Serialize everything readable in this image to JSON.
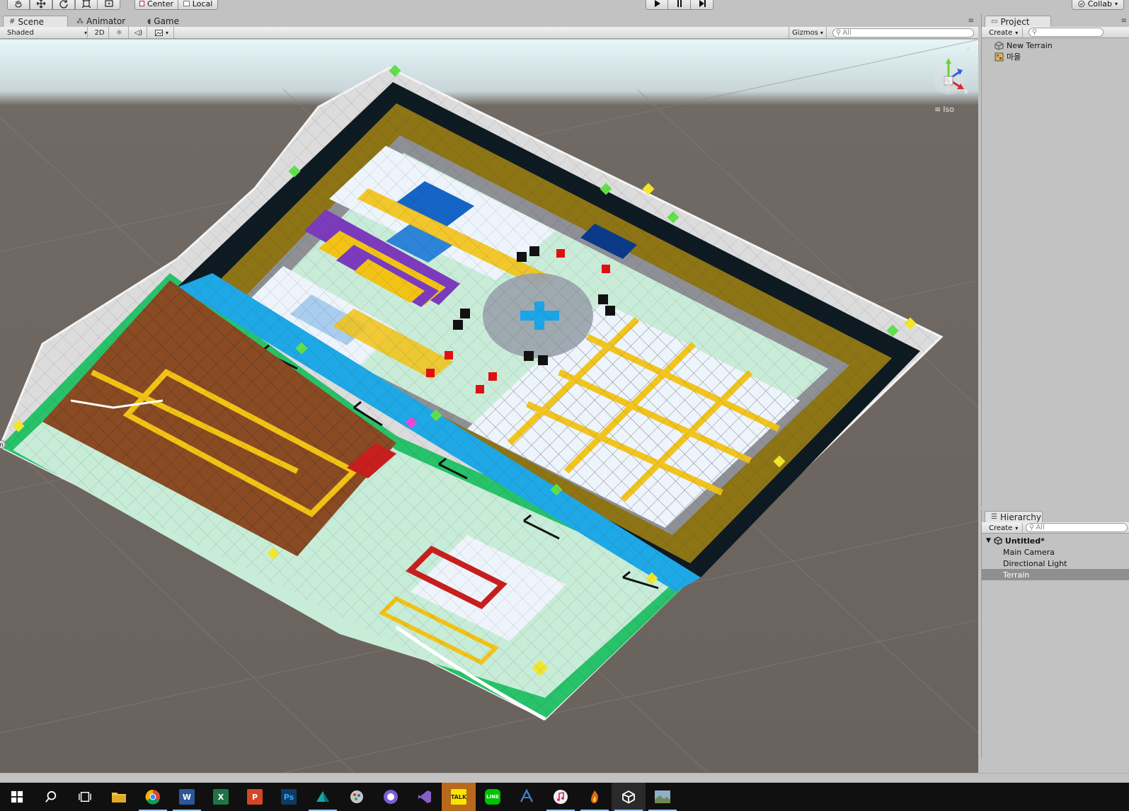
{
  "toolbar": {
    "pivot_center": "Center",
    "pivot_local": "Local",
    "collab": "Collab"
  },
  "scene": {
    "tabs": [
      {
        "label": "Scene",
        "icon": "grid-icon"
      },
      {
        "label": "Animator",
        "icon": "animator-icon"
      },
      {
        "label": "Game",
        "icon": "game-icon"
      }
    ],
    "shading_mode": "Shaded",
    "mode_2d": "2D",
    "gizmos_label": "Gizmos",
    "search_placeholder": "All",
    "projection_label": "Iso",
    "gizmo_axis_x": "x"
  },
  "project": {
    "tab_label": "Project",
    "create_label": "Create",
    "items": [
      {
        "label": "New Terrain",
        "icon": "terrain-asset-icon"
      },
      {
        "label": "마을",
        "icon": "scene-asset-icon"
      }
    ]
  },
  "hierarchy": {
    "tab_label": "Hierarchy",
    "create_label": "Create",
    "search_placeholder": "All",
    "scene_name": "Untitled*",
    "items": [
      {
        "label": "Main Camera",
        "selected": false
      },
      {
        "label": "Directional Light",
        "selected": false
      },
      {
        "label": "Terrain",
        "selected": true
      }
    ]
  },
  "taskbar": {
    "apps": [
      {
        "name": "windows-start-icon"
      },
      {
        "name": "search-icon"
      },
      {
        "name": "task-view-icon"
      },
      {
        "name": "file-explorer-icon",
        "color": "#f2c43d"
      },
      {
        "name": "chrome-icon"
      },
      {
        "name": "word-icon",
        "text": "W",
        "color": "#2b579a"
      },
      {
        "name": "excel-icon",
        "text": "X",
        "color": "#217346"
      },
      {
        "name": "powerpoint-icon",
        "text": "P",
        "color": "#d24726"
      },
      {
        "name": "photoshop-icon",
        "text": "Ps",
        "color": "#0f3a63"
      },
      {
        "name": "3d-app-icon",
        "color": "#1aa3a3"
      },
      {
        "name": "paint-app-icon",
        "color": "#c7c7c7"
      },
      {
        "name": "chat-app-icon",
        "color": "#7b5ed6"
      },
      {
        "name": "visual-studio-icon",
        "color": "#865fc5"
      },
      {
        "name": "kakaotalk-icon",
        "text": "TALK",
        "color": "#f7e600"
      },
      {
        "name": "line-icon",
        "text": "LINE",
        "color": "#00c300"
      },
      {
        "name": "blender-like-icon",
        "color": "#3d7fc2"
      },
      {
        "name": "itunes-icon",
        "color": "#f0f0f0"
      },
      {
        "name": "flame-app-icon",
        "color": "#e2671d"
      },
      {
        "name": "unity-icon",
        "color": "#ffffff"
      },
      {
        "name": "photo-app-icon",
        "color": "#6d8a55"
      }
    ]
  }
}
